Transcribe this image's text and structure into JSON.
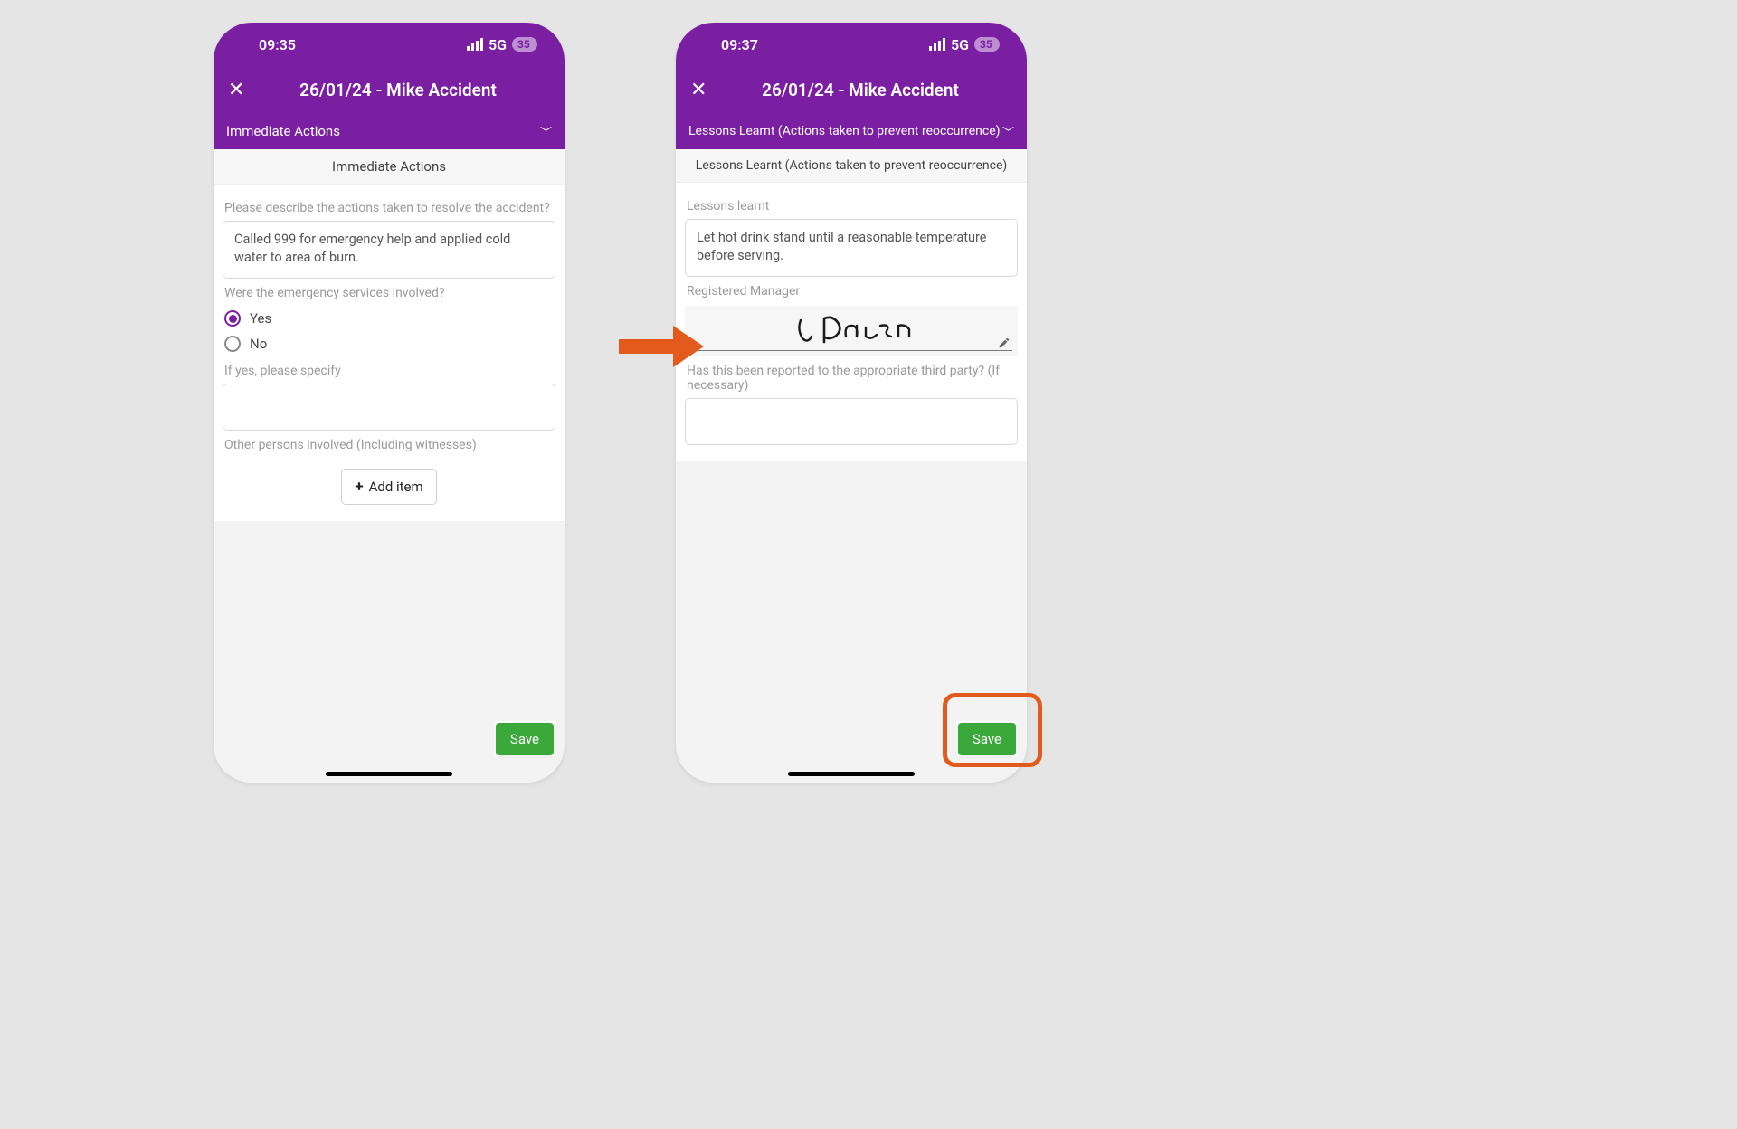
{
  "screen_left": {
    "status": {
      "time": "09:35",
      "network": "5G",
      "battery": "35"
    },
    "header": {
      "title": "26/01/24 - Mike Accident"
    },
    "dropdown": {
      "label": "Immediate Actions"
    },
    "section_title": "Immediate Actions",
    "fields": {
      "actions_label": "Please describe the actions taken to resolve the accident?",
      "actions_value": "Called 999 for emergency help and applied cold water to area of burn.",
      "emergency_label": "Were the emergency services involved?",
      "emergency_yes": "Yes",
      "emergency_no": "No",
      "specify_label": "If yes, please specify",
      "others_label": "Other persons involved (Including witnesses)",
      "add_item_label": "Add item"
    },
    "save_label": "Save"
  },
  "screen_right": {
    "status": {
      "time": "09:37",
      "network": "5G",
      "battery": "35"
    },
    "header": {
      "title": "26/01/24 - Mike Accident"
    },
    "dropdown": {
      "label": "Lessons Learnt (Actions taken to prevent reoccurrence)"
    },
    "section_title": "Lessons Learnt (Actions taken to prevent reoccurrence)",
    "fields": {
      "lessons_label": "Lessons learnt",
      "lessons_value": "Let hot drink stand until a reasonable temperature before serving.",
      "manager_label": "Registered Manager",
      "reported_label": "Has this been reported to the appropriate third party? (If necessary)"
    },
    "save_label": "Save"
  }
}
